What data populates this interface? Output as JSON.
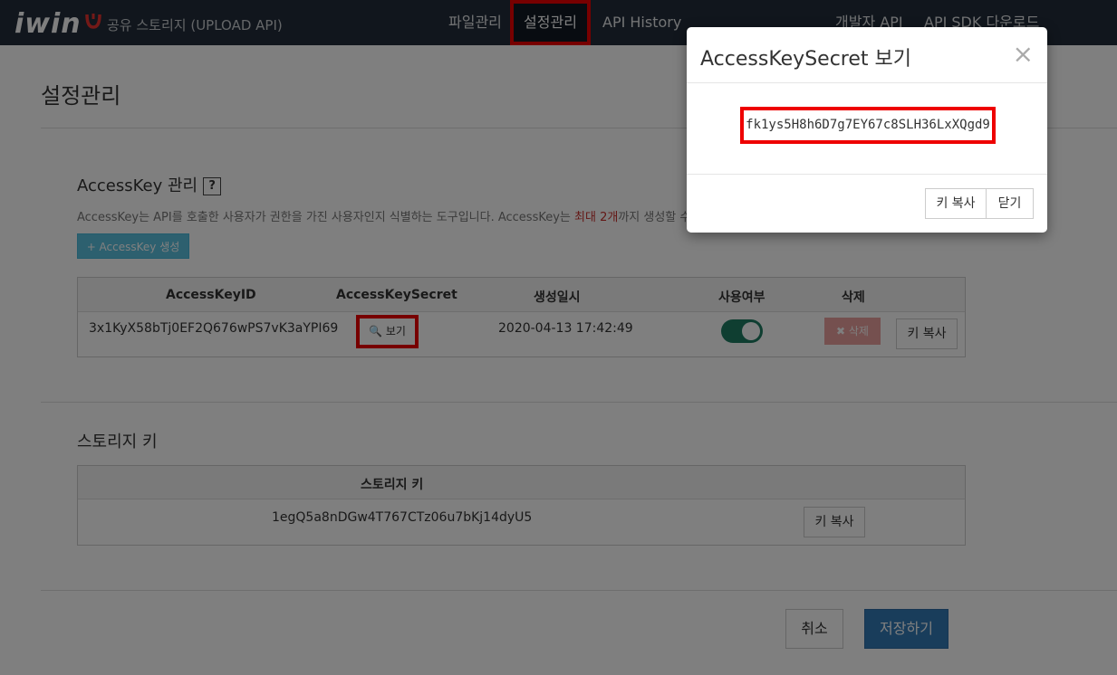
{
  "navbar": {
    "logo_text": "iwin",
    "brand_sub": "공유 스토리지 (UPLOAD API)",
    "items": [
      {
        "label": "파일관리"
      },
      {
        "label": "설정관리"
      },
      {
        "label": "API History"
      },
      {
        "label": "개발자 API"
      },
      {
        "label": "API SDK 다운로드"
      }
    ]
  },
  "page": {
    "title": "설정관리",
    "accesskey": {
      "section_title": "AccessKey 관리",
      "help_label": "?",
      "desc_before": "AccessKey는 API를 호출한 사용자가 권한을 가진 사용자인지 식별하는 도구입니다. AccessKey는 ",
      "desc_highlight": "최대 2개",
      "desc_after": "까지 생성할 수 있습니다.",
      "create_button": "+ AccessKey 생성",
      "columns": [
        "AccessKeyID",
        "AccessKeySecret",
        "생성일시",
        "사용여부",
        "삭제"
      ],
      "rows": [
        {
          "id": "3x1KyX58bTj0EF2Q676wPS7vK3aYPI69",
          "view_button": "보기",
          "created": "2020-04-13 17:42:49",
          "enabled": true,
          "delete_button": "삭제",
          "copy_button": "키 복사"
        }
      ]
    },
    "storage": {
      "section_title": "스토리지 키",
      "column": "스토리지 키",
      "key": "1egQ5a8nDGw4T767CTz06u7bKj14dyU5",
      "copy_button": "키 복사"
    },
    "footer": {
      "cancel_button": "취소",
      "save_button": "저장하기"
    }
  },
  "modal": {
    "title": "AccessKeySecret 보기",
    "close_symbol": "×",
    "secret": "fk1ys5H8h6D7g7EY67c8SLH36LxXQgd9",
    "copy_button": "키 복사",
    "close_button": "닫기"
  },
  "colors": {
    "navbar_bg": "#222d3a",
    "highlight": "#ee0000",
    "info_button": "#5bc0de",
    "primary_button": "#337ab7",
    "toggle_on": "#1e7d63",
    "danger": "#d9534f"
  }
}
